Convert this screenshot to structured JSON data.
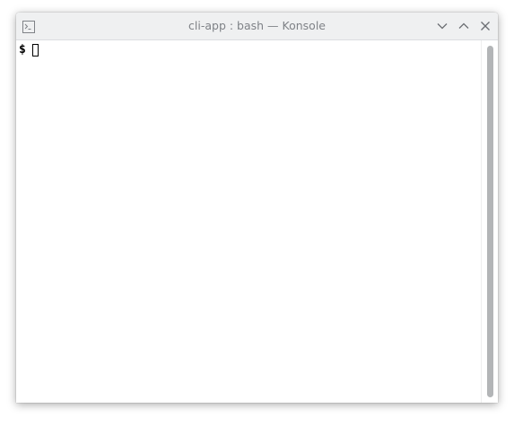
{
  "window": {
    "title": "cli-app : bash — Konsole",
    "icon": "terminal-icon",
    "controls": [
      {
        "name": "minimize",
        "icon": "chevron-down-icon"
      },
      {
        "name": "maximize",
        "icon": "chevron-up-icon"
      },
      {
        "name": "close",
        "icon": "close-icon"
      }
    ]
  },
  "terminal": {
    "prompt": "$",
    "input": ""
  },
  "colors": {
    "titlebar": "#eff0f1",
    "title_text": "#7f8287",
    "terminal_bg": "#ffffff",
    "terminal_fg": "#000000",
    "scrollbar_thumb": "#b3b5b7"
  }
}
